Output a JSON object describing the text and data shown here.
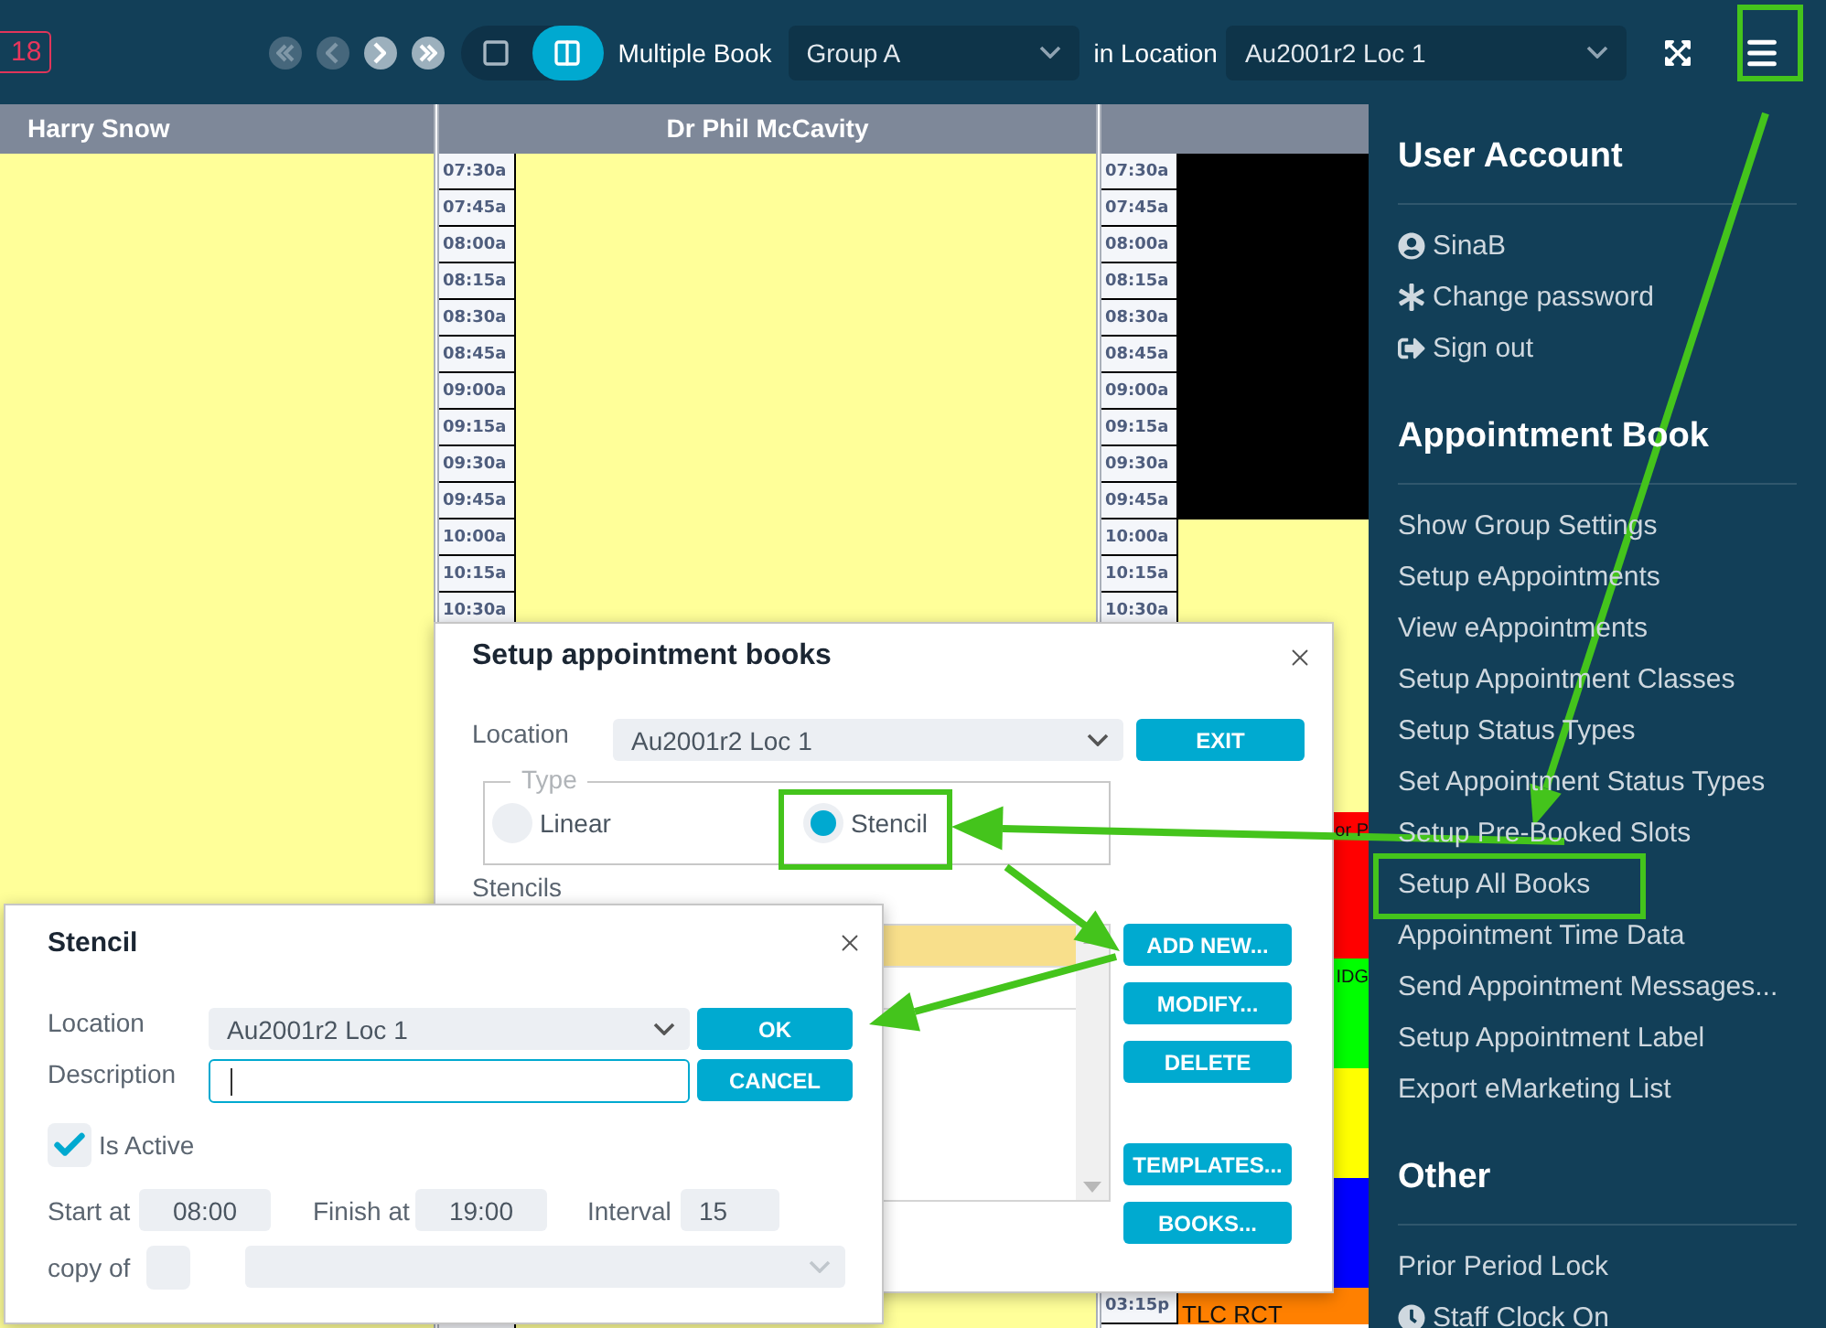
{
  "top_bar": {
    "date_badge": "18",
    "nav_buttons": [
      {
        "kind": "first",
        "disabled": true
      },
      {
        "kind": "previous",
        "disabled": true
      },
      {
        "kind": "next",
        "disabled": false
      },
      {
        "kind": "last",
        "disabled": false
      }
    ],
    "view_modes": [
      {
        "kind": "single",
        "selected": false
      },
      {
        "kind": "multiple",
        "selected": true
      }
    ],
    "mode_label": "Multiple Book",
    "group_select": {
      "value": "Group A"
    },
    "location_label": "in Location",
    "location_select": {
      "value": "Au2001r2 Loc 1"
    }
  },
  "columns": [
    {
      "header": "Harry Snow"
    },
    {
      "header": "Dr Phil McCavity",
      "times": [
        "07:30a",
        "07:45a",
        "08:00a",
        "08:15a",
        "08:30a",
        "08:45a",
        "09:00a",
        "09:15a",
        "09:30a",
        "09:45a",
        "10:00a",
        "10:15a",
        "10:30a"
      ]
    },
    {
      "slots": [
        {
          "time": "07:30a",
          "color": "#000000"
        },
        {
          "time": "07:45a",
          "color": "#000000"
        },
        {
          "time": "08:00a",
          "color": "#000000"
        },
        {
          "time": "08:15a",
          "color": "#000000"
        },
        {
          "time": "08:30a",
          "color": "#000000"
        },
        {
          "time": "08:45a",
          "color": "#000000"
        },
        {
          "time": "09:00a",
          "color": "#000000"
        },
        {
          "time": "09:15a",
          "color": "#000000"
        },
        {
          "time": "09:30a",
          "color": "#000000"
        },
        {
          "time": "09:45a",
          "color": "#000000"
        },
        {
          "time": "10:00a",
          "color": "#ffff99"
        },
        {
          "time": "10:15a",
          "color": "#ffff99"
        },
        {
          "time": "10:30a",
          "color": "#ffff99"
        },
        {
          "color": "#ffff99"
        },
        {
          "color": "#ffff99"
        },
        {
          "color": "#ffff99"
        },
        {
          "color": "#ffff99"
        },
        {
          "color": "#ffff99"
        },
        {
          "color": "#ff0000",
          "text": "or P"
        },
        {
          "color": "#ff0000"
        },
        {
          "color": "#ff0000"
        },
        {
          "color": "#ff0000"
        },
        {
          "color": "#00ff00",
          "text": "IDG"
        },
        {
          "color": "#00ff00"
        },
        {
          "color": "#00ff00"
        },
        {
          "color": "#ffff00"
        },
        {
          "color": "#ffff00"
        },
        {
          "color": "#ffff00"
        },
        {
          "color": "#0000ff"
        },
        {
          "color": "#0000ff"
        },
        {
          "color": "#0000ff"
        },
        {
          "time": "03:15p",
          "color": "#ff8000",
          "text": "TLC RCT"
        }
      ]
    }
  ],
  "menu": {
    "sections": [
      {
        "heading": "User Account",
        "items": [
          {
            "label": "SinaB",
            "kind": "account"
          },
          {
            "label": "Change password",
            "kind": "password"
          },
          {
            "label": "Sign out",
            "kind": "sign_out"
          }
        ]
      },
      {
        "heading": "Appointment Book",
        "items": [
          {
            "label": "Show Group Settings",
            "kind": "link"
          },
          {
            "label": "Setup eAppointments",
            "kind": "link"
          },
          {
            "label": "View eAppointments",
            "kind": "link"
          },
          {
            "label": "Setup Appointment Classes",
            "kind": "link"
          },
          {
            "label": "Setup Status Types",
            "kind": "link"
          },
          {
            "label": "Set Appointment Status Types",
            "kind": "link"
          },
          {
            "label": "Setup Pre-Booked Slots",
            "kind": "link"
          },
          {
            "label": "Setup All Books",
            "kind": "link"
          },
          {
            "label": "Appointment Time Data",
            "kind": "link"
          },
          {
            "label": "Send Appointment Messages...",
            "kind": "link"
          },
          {
            "label": "Setup Appointment Label",
            "kind": "link"
          },
          {
            "label": "Export eMarketing List",
            "kind": "link"
          }
        ]
      },
      {
        "heading": "Other",
        "items": [
          {
            "label": "Prior Period Lock",
            "kind": "link"
          },
          {
            "label": "Staff Clock On",
            "kind": "clock"
          }
        ]
      }
    ]
  },
  "setup_dialog": {
    "title": "Setup appointment books",
    "location_label": "Location",
    "location_select": {
      "value": "Au2001r2 Loc 1"
    },
    "exit_button": "EXIT",
    "type_legend": "Type",
    "types": [
      {
        "label": "Linear",
        "selected": false
      },
      {
        "label": "Stencil",
        "selected": true
      }
    ],
    "stencils_label": "Stencils",
    "stencil_rows": [
      {
        "selected": true
      },
      {
        "selected": false
      }
    ],
    "actions": [
      "ADD NEW...",
      "MODIFY...",
      "DELETE"
    ],
    "more_actions": [
      "TEMPLATES...",
      "BOOKS..."
    ]
  },
  "stencil_dialog": {
    "title": "Stencil",
    "location_label": "Location",
    "location_select": {
      "value": "Au2001r2 Loc 1"
    },
    "ok_button": "OK",
    "description_label": "Description",
    "description_field": {
      "focused": true
    },
    "cancel_button": "CANCEL",
    "is_active": {
      "label": "Is Active",
      "checked": true
    },
    "start_label": "Start at",
    "start_value": "08:00",
    "finish_label": "Finish at",
    "finish_value": "19:00",
    "interval_label": "Interval",
    "interval_value": "15",
    "copy_label": "copy of",
    "copy_checked": false
  }
}
